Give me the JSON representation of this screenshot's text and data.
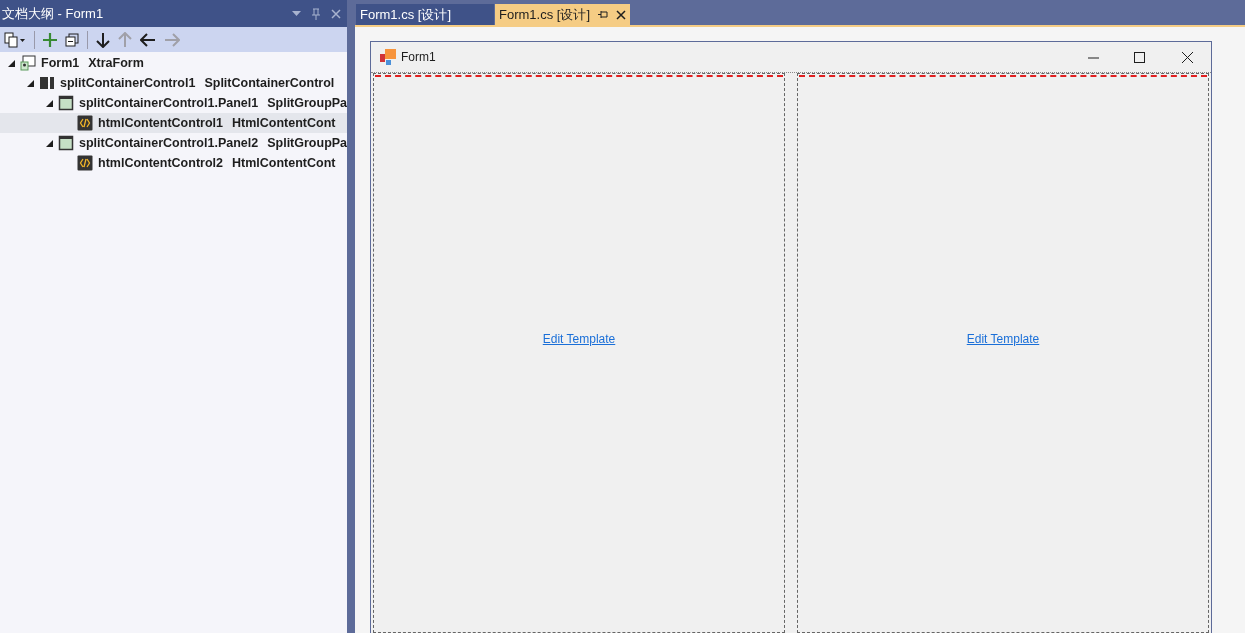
{
  "outline_panel": {
    "title": "文档大纲 - Form1",
    "tree": [
      {
        "name": "Form1",
        "type": "XtraForm",
        "kind": "form",
        "expanded": true,
        "selected": false,
        "children": [
          {
            "name": "splitContainerControl1",
            "type": "SplitContainerControl",
            "kind": "split",
            "expanded": true,
            "selected": false,
            "children": [
              {
                "name": "splitContainerControl1.Panel1",
                "type": "SplitGroupPa",
                "kind": "panel",
                "expanded": true,
                "selected": false,
                "children": [
                  {
                    "name": "htmlContentControl1",
                    "type": "HtmlContentCont",
                    "kind": "html",
                    "selected": true
                  }
                ]
              },
              {
                "name": "splitContainerControl1.Panel2",
                "type": "SplitGroupPa",
                "kind": "panel",
                "expanded": true,
                "selected": false,
                "children": [
                  {
                    "name": "htmlContentControl2",
                    "type": "HtmlContentCont",
                    "kind": "html",
                    "selected": false
                  }
                ]
              }
            ]
          }
        ]
      }
    ]
  },
  "tabs": [
    {
      "label": "Form1.cs [设计]",
      "selected": false
    },
    {
      "label": "Form1.cs [设计]",
      "selected": true
    }
  ],
  "form": {
    "title": "Form1",
    "panels": [
      {
        "link": "Edit Template"
      },
      {
        "link": "Edit Template"
      }
    ]
  }
}
